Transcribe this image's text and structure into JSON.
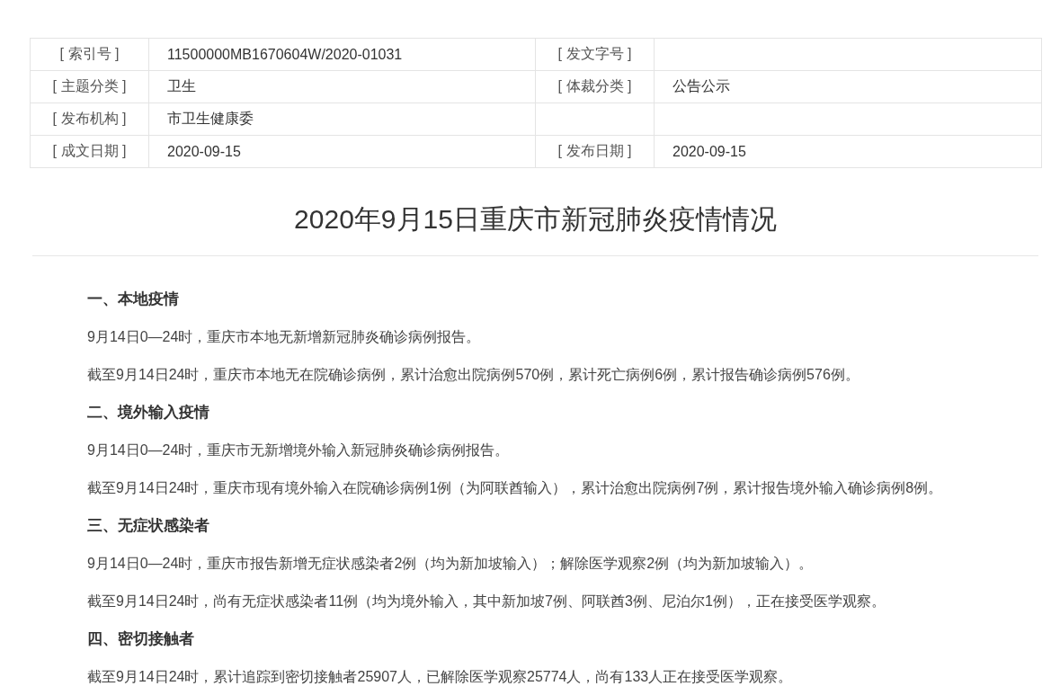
{
  "meta_table": {
    "rows": [
      {
        "label": "[ 索引号 ]",
        "value": "11500000MB1670604W/2020-01031",
        "label_2": "[ 发文字号 ]"
      },
      {
        "label": "[ 主题分类 ]",
        "value": "卫生",
        "label_2": "[ 体裁分类 ]",
        "value_2": "公告公示"
      },
      {
        "label": "[ 发布机构 ]",
        "value": "市卫生健康委"
      },
      {
        "label": "[ 成文日期 ]",
        "value": "2020-09-15",
        "label_2": "[ 发布日期 ]",
        "value_2": "2020-09-15"
      }
    ]
  },
  "article": {
    "title": "2020年9月15日重庆市新冠肺炎疫情情况",
    "sections": [
      {
        "heading": "一、本地疫情",
        "paragraphs": [
          "9月14日0—24时，重庆市本地无新增新冠肺炎确诊病例报告。",
          "截至9月14日24时，重庆市本地无在院确诊病例，累计治愈出院病例570例，累计死亡病例6例，累计报告确诊病例576例。"
        ]
      },
      {
        "heading": "二、境外输入疫情",
        "paragraphs": [
          "9月14日0—24时，重庆市无新增境外输入新冠肺炎确诊病例报告。",
          "截至9月14日24时，重庆市现有境外输入在院确诊病例1例（为阿联酋输入），累计治愈出院病例7例，累计报告境外输入确诊病例8例。"
        ]
      },
      {
        "heading": "三、无症状感染者",
        "paragraphs": [
          "9月14日0—24时，重庆市报告新增无症状感染者2例（均为新加坡输入）；解除医学观察2例（均为新加坡输入）。",
          "截至9月14日24时，尚有无症状感染者11例（均为境外输入，其中新加坡7例、阿联酋3例、尼泊尔1例），正在接受医学观察。"
        ]
      },
      {
        "heading": "四、密切接触者",
        "paragraphs": [
          "截至9月14日24时，累计追踪到密切接触者25907人，已解除医学观察25774人，尚有133人正在接受医学观察。"
        ]
      }
    ]
  }
}
